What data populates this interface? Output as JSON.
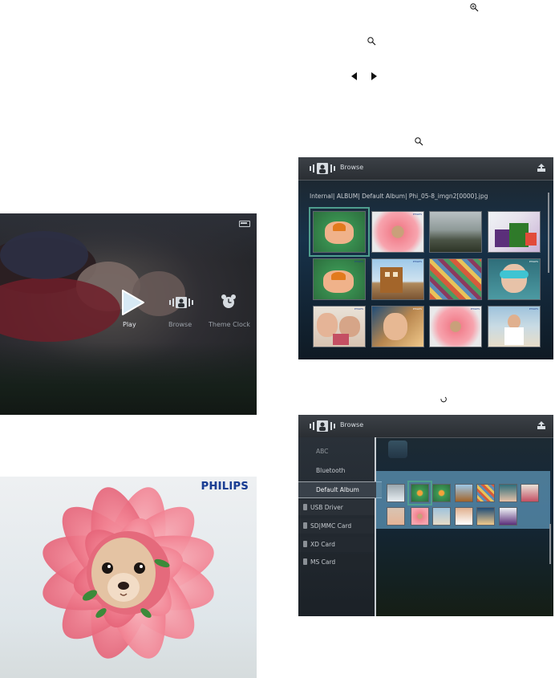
{
  "icons": {
    "zoom_in": "zoom-in-icon",
    "magnifier": "magnifier-icon",
    "arrow_left": "left-arrow-icon",
    "arrow_right": "right-arrow-icon",
    "busy": "busy-icon"
  },
  "main_menu": {
    "items": [
      {
        "label": "Play",
        "icon": "play-icon"
      },
      {
        "label": "Browse",
        "icon": "browse-icon"
      },
      {
        "label": "Theme Clock",
        "icon": "clock-icon"
      }
    ]
  },
  "browse_grid": {
    "title": "Browse",
    "path": "Internal| ALBUM| Default Album| Phi_05-8_imgn2[0000].jpg"
  },
  "browse_list": {
    "title": "Browse",
    "sources": [
      {
        "label": "ABC",
        "type": "album"
      },
      {
        "label": "Bluetooth",
        "type": "album"
      },
      {
        "label": "Default Album",
        "type": "album",
        "selected": true
      },
      {
        "label": "USB Driver",
        "type": "card"
      },
      {
        "label": "SD|MMC Card",
        "type": "card"
      },
      {
        "label": "XD Card",
        "type": "card"
      },
      {
        "label": "MS Card",
        "type": "card"
      }
    ]
  },
  "photo": {
    "brand": "PHILIPS"
  },
  "colors": {
    "selection_outline": "#4f9e8e",
    "philips_blue": "#1c3f94",
    "flower_pink": "#f07a8a"
  }
}
